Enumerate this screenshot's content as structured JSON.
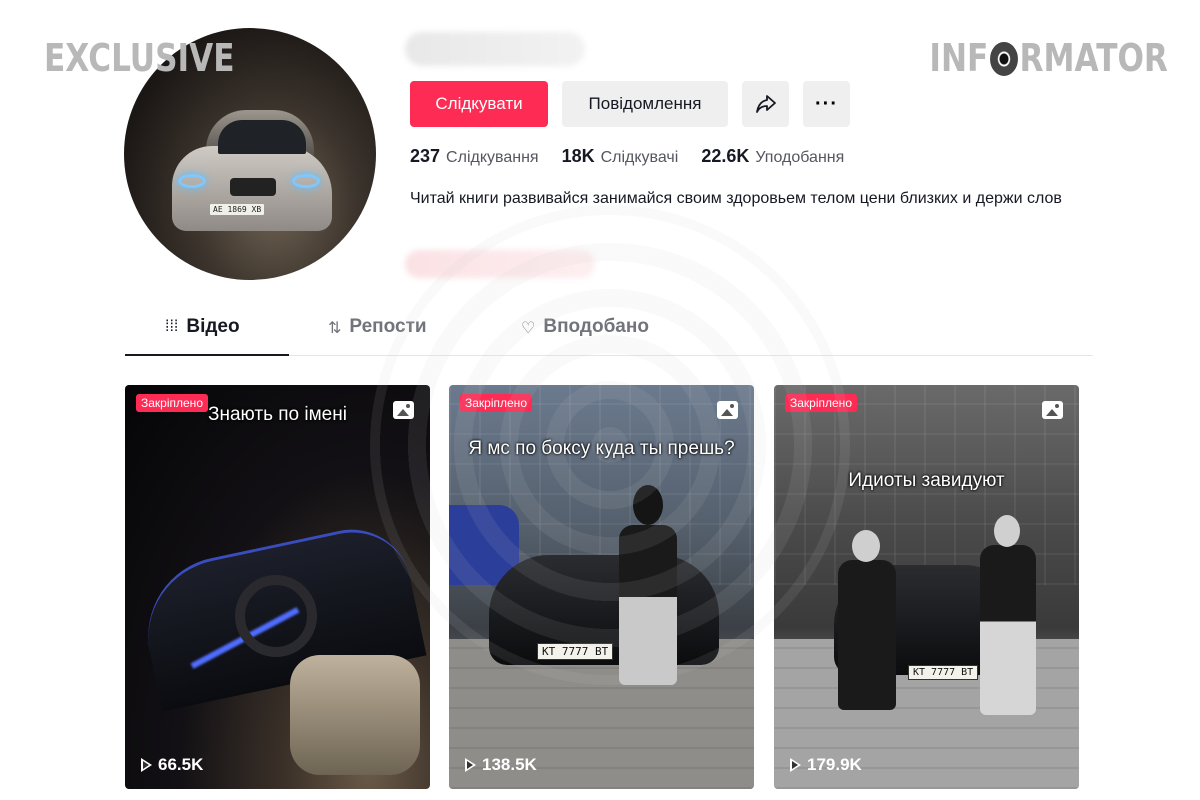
{
  "watermarks": {
    "left": "EXCLUSIVE",
    "right_a": "INF",
    "right_b": "RMATOR"
  },
  "profile": {
    "avatar_plate": "AE 1869 XB",
    "follow_label": "Слідкувати",
    "message_label": "Повідомлення",
    "more_label": "···",
    "stats": [
      {
        "value": "237",
        "label": "Слідкування"
      },
      {
        "value": "18K",
        "label": "Слідкувачі"
      },
      {
        "value": "22.6K",
        "label": "Уподобання"
      }
    ],
    "bio": "Читай книги развивайся занимайся своим здоровьем телом цени близких и держи слов"
  },
  "tabs": [
    {
      "label": "Відео",
      "icon": "grid-icon",
      "active": true
    },
    {
      "label": "Репости",
      "icon": "repost-icon",
      "active": false
    },
    {
      "label": "Вподобано",
      "icon": "heart-icon",
      "active": false
    }
  ],
  "videos": [
    {
      "badge": "Закріплено",
      "caption": "Знають по імені",
      "views": "66.5K",
      "plate": ""
    },
    {
      "badge": "Закріплено",
      "caption": "Я мс по боксу куда ты прешь?",
      "views": "138.5K",
      "plate": "KT 7777 BT"
    },
    {
      "badge": "Закріплено",
      "caption": "Идиоты завидуют",
      "views": "179.9K",
      "plate": "KT 7777 BT"
    }
  ],
  "colors": {
    "accent": "#fe2c55",
    "button_gray": "#efefef",
    "text_primary": "#161823",
    "text_secondary": "#555760"
  }
}
